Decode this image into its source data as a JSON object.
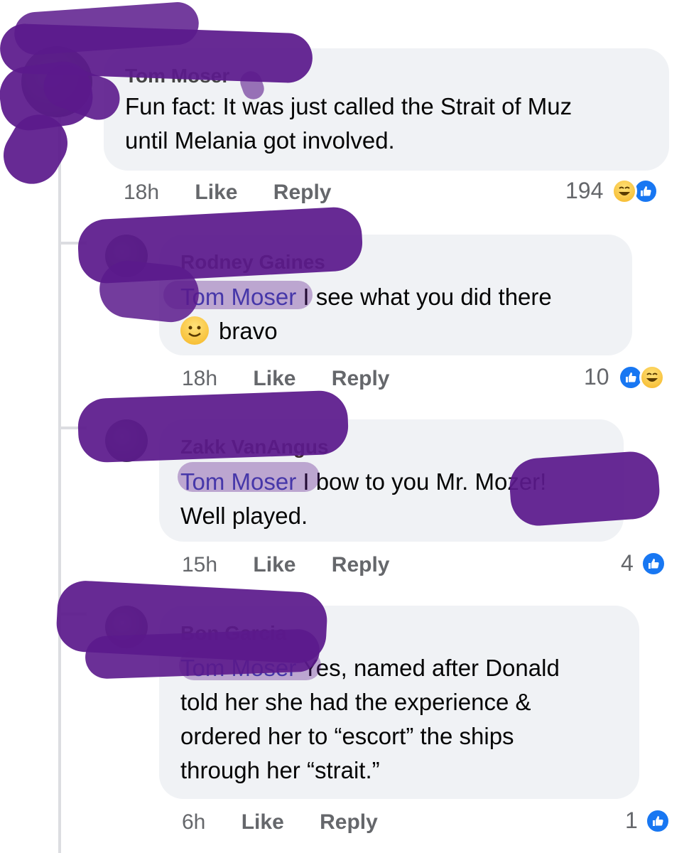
{
  "comments": [
    {
      "author": "Tom Moser",
      "text_lines": [
        "Fun fact: It was just called the Strait of Muz",
        "until Melania got involved."
      ],
      "time": "18h",
      "like_label": "Like",
      "reply_label": "Reply",
      "reaction_count": "194",
      "reactions": [
        "haha",
        "like"
      ]
    },
    {
      "author": "Rodney Gaines",
      "mention": "Tom Moser",
      "text_after_mention": " I see what you did there",
      "text_line2": "bravo",
      "time": "18h",
      "like_label": "Like",
      "reply_label": "Reply",
      "reaction_count": "10",
      "reactions": [
        "like",
        "haha"
      ]
    },
    {
      "author": "Zakk VanAngus",
      "mention": "Tom Moser",
      "text_after_mention": " I bow to you Mr. Mozer!",
      "text_line2": "Well played.",
      "time": "15h",
      "like_label": "Like",
      "reply_label": "Reply",
      "reaction_count": "4",
      "reactions": [
        "like"
      ]
    },
    {
      "author": "Bon Garcia",
      "mention": "Tom Moser",
      "text_after_mention": " Yes, named after Donald",
      "text_lines": [
        "told her she had the experience &",
        "ordered her to “escort” the ships",
        "through her “strait.”"
      ],
      "time": "6h",
      "like_label": "Like",
      "reply_label": "Reply",
      "reaction_count": "1",
      "reactions": [
        "like"
      ]
    }
  ],
  "colors": {
    "bubble": "#f0f2f5",
    "mention": "#3b47b8",
    "meta": "#65676b",
    "like_blue": "#1877f2",
    "scribble": "#5b1a8c"
  }
}
